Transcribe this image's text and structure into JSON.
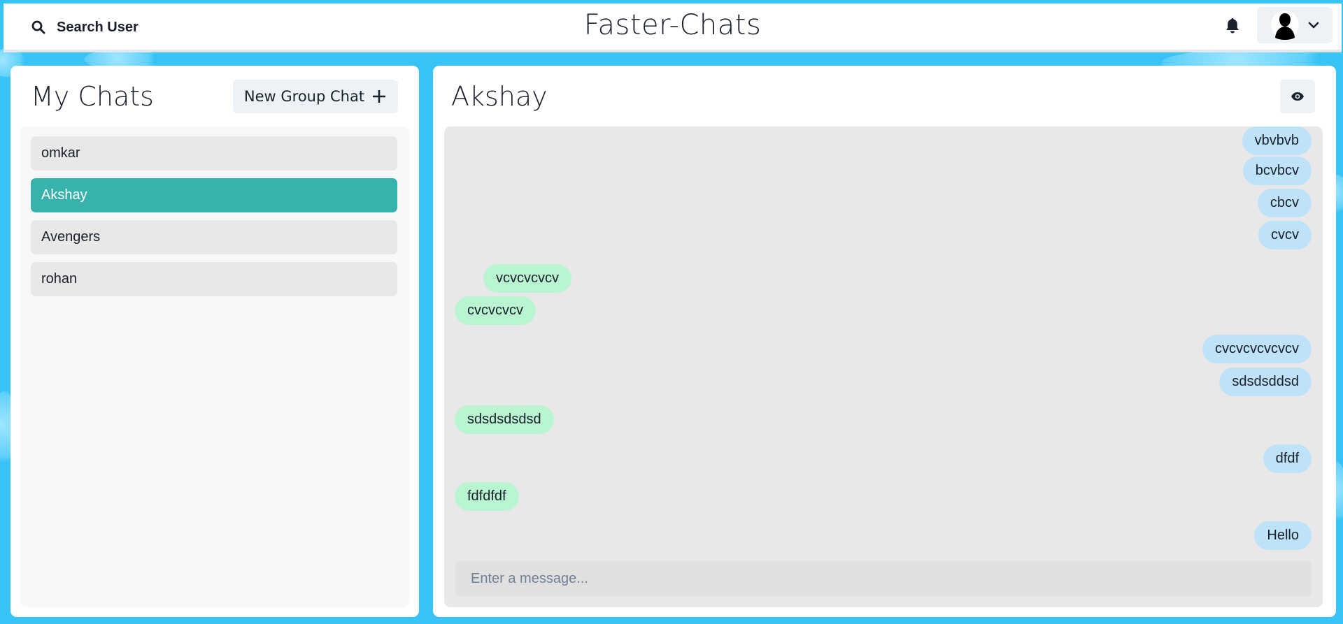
{
  "header": {
    "search_label": "Search User",
    "app_title": "Faster-Chats",
    "icons": {
      "search": "search-icon",
      "notifications": "bell-icon",
      "avatar": "avatar-icon",
      "menu": "chevron-down-icon"
    }
  },
  "sidebar": {
    "title": "My Chats",
    "new_group_label": "New Group Chat",
    "chats": [
      {
        "name": "omkar",
        "active": false
      },
      {
        "name": "Akshay",
        "active": true
      },
      {
        "name": "Avengers",
        "active": false
      },
      {
        "name": "rohan",
        "active": false
      }
    ]
  },
  "chat": {
    "title": "Akshay",
    "view_profile_icon": "eye-icon",
    "messages": [
      {
        "text": "vbvbvb",
        "from": "me"
      },
      {
        "text": "bcvbcv",
        "from": "me"
      },
      {
        "text": "cbcv",
        "from": "me"
      },
      {
        "text": "cvcv",
        "from": "me"
      },
      {
        "text": "vcvcvcvcv",
        "from": "other"
      },
      {
        "text": "cvcvcvcv",
        "from": "other"
      },
      {
        "text": "cvcvcvcvcvcv",
        "from": "me"
      },
      {
        "text": "sdsdsddsd",
        "from": "me"
      },
      {
        "text": "sdsdsdsdsd",
        "from": "other"
      },
      {
        "text": "dfdf",
        "from": "me"
      },
      {
        "text": "fdfdfdf",
        "from": "other"
      },
      {
        "text": "Hello",
        "from": "me"
      }
    ],
    "input_placeholder": "Enter a message..."
  },
  "colors": {
    "background": "#37c3f5",
    "active_chat": "#38b2ac",
    "sent_bubble": "#bee3f8",
    "received_bubble": "#b9f5d0"
  }
}
